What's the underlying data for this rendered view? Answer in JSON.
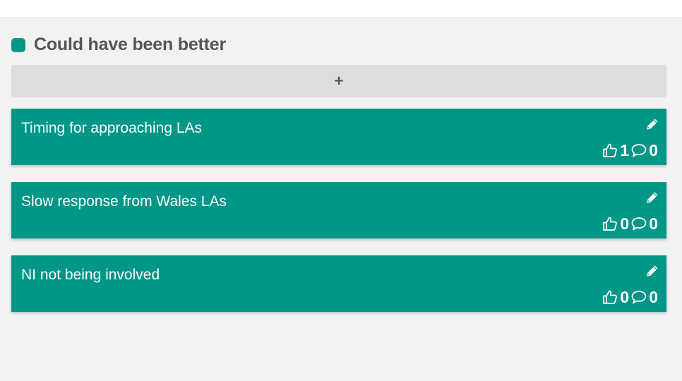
{
  "column": {
    "title": "Could have been better",
    "accent_color": "#009688",
    "add_label": "+"
  },
  "cards": [
    {
      "text": "Timing for approaching LAs",
      "votes": "1",
      "comments": "0"
    },
    {
      "text": "Slow response from Wales LAs",
      "votes": "0",
      "comments": "0"
    },
    {
      "text": "NI not being involved",
      "votes": "0",
      "comments": "0"
    }
  ],
  "icons": {
    "edit": "pencil-icon",
    "vote": "thumbs-up-icon",
    "comment": "comment-icon"
  }
}
